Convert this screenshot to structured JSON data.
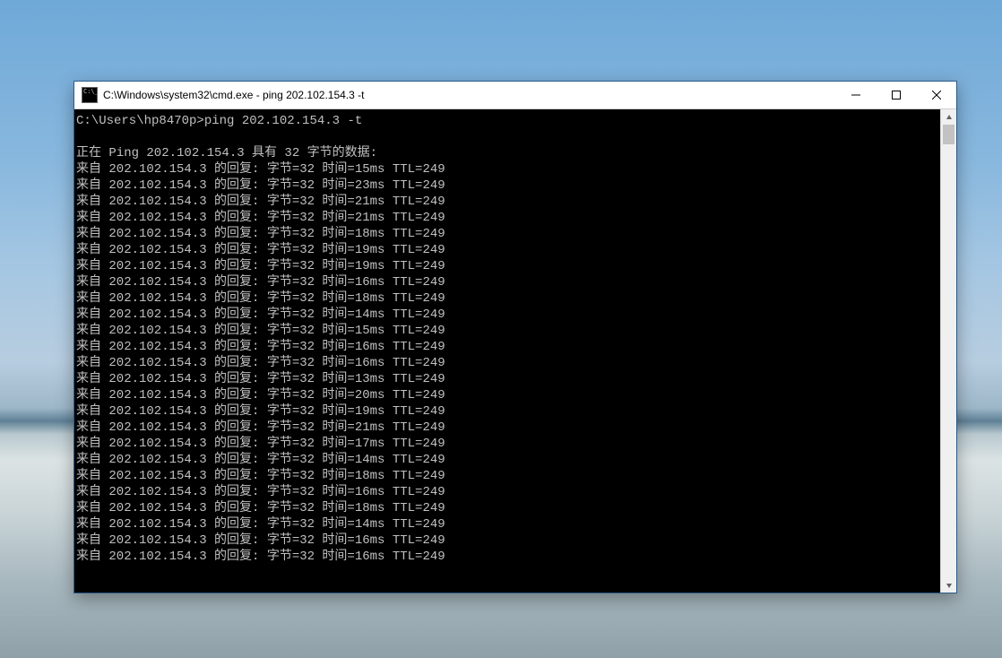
{
  "window": {
    "title": "C:\\Windows\\system32\\cmd.exe - ping  202.102.154.3 -t"
  },
  "console": {
    "prompt": "C:\\Users\\hp8470p>ping 202.102.154.3 -t",
    "header": "正在 Ping 202.102.154.3 具有 32 字节的数据:",
    "ip": "202.102.154.3",
    "bytes": "32",
    "ttl": "249",
    "reply_prefix": "来自 ",
    "reply_mid": " 的回复: 字节=",
    "time_label": " 时间=",
    "ttl_label": "ms TTL=",
    "times_ms": [
      15,
      23,
      21,
      21,
      18,
      19,
      19,
      16,
      18,
      14,
      15,
      16,
      16,
      13,
      20,
      19,
      21,
      17,
      14,
      18,
      16,
      18,
      14,
      16,
      16
    ]
  }
}
